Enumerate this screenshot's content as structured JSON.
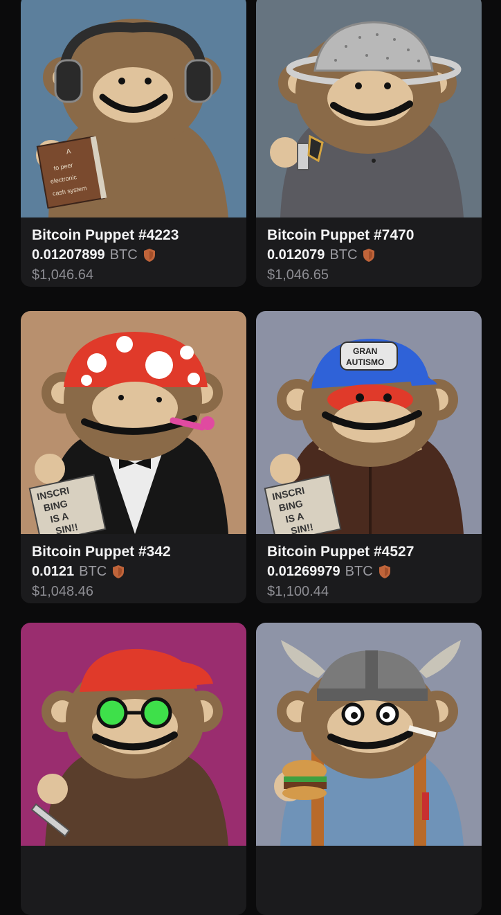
{
  "listings": [
    {
      "name": "Bitcoin Puppet #4223",
      "price": "0.01207899",
      "currency": "BTC",
      "usd": "$1,046.64",
      "background": "#5c7f9c",
      "book_text": [
        "A",
        "to peer",
        "electronic",
        "cash system"
      ]
    },
    {
      "name": "Bitcoin Puppet #7470",
      "price": "0.012079",
      "currency": "BTC",
      "usd": "$1,046.65",
      "background": "#667480"
    },
    {
      "name": "Bitcoin Puppet #342",
      "price": "0.0121",
      "currency": "BTC",
      "usd": "$1,048.46",
      "background": "#b8906e",
      "sign_text": [
        "INSCRI",
        "BING",
        "IS A",
        "SIN!!"
      ]
    },
    {
      "name": "Bitcoin Puppet #4527",
      "price": "0.01269979",
      "currency": "BTC",
      "usd": "$1,100.44",
      "background": "#8c91a4",
      "cap_text": [
        "GRAN",
        "AUTISMO"
      ],
      "sign_text": [
        "INSCRI",
        "BING",
        "IS A",
        "SIN!!"
      ]
    },
    {
      "name": "",
      "price": "",
      "currency": "",
      "usd": "",
      "background": "#9a2d6f"
    },
    {
      "name": "",
      "price": "",
      "currency": "",
      "usd": "",
      "background": "#8e94a7"
    }
  ],
  "colors": {
    "page_bg": "#0b0b0c",
    "card_bg": "#1b1b1d",
    "shield": "#c0643a"
  },
  "icons": {
    "verified": "shield-icon"
  }
}
